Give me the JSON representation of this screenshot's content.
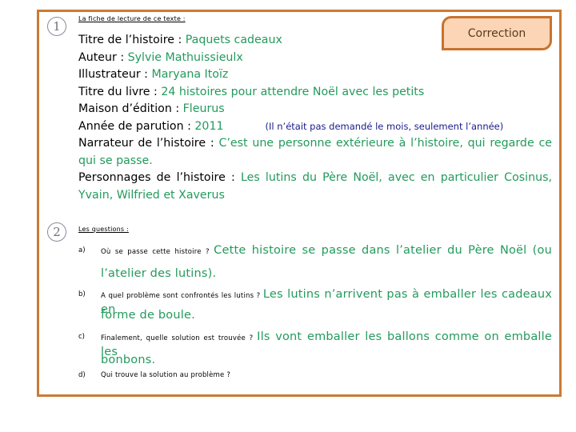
{
  "section1": {
    "number": "1",
    "heading": "La fiche de lecture de ce texte :"
  },
  "badge": {
    "label": "Correction"
  },
  "fiche": {
    "titre": {
      "label": "Titre de l’histoire : ",
      "value": "Paquets cadeaux"
    },
    "auteur": {
      "label": "Auteur : ",
      "value": "Sylvie Mathuissieulx"
    },
    "illustrateur": {
      "label": "Illustrateur : ",
      "value": "Maryana Itoïz"
    },
    "livre": {
      "label": "Titre du livre : ",
      "value": "24 histoires pour attendre Noël avec les petits"
    },
    "edition": {
      "label": "Maison d’édition : ",
      "value": "Fleurus"
    },
    "annee": {
      "label": "Année de parution : ",
      "value": "2011",
      "note": "(Il n’était pas demandé le mois, seulement l’année)"
    },
    "narrateur": {
      "label": "Narrateur de l’histoire : ",
      "value": "C’est une personne extérieure à l’histoire, qui regarde ce qui se passe."
    },
    "personnages": {
      "label": "Personnages de l’histoire : ",
      "value": "Les lutins du Père Noël, avec en particulier Cosinus, Yvain, Wilfried et Xaverus"
    }
  },
  "section2": {
    "number": "2",
    "heading": "Les questions :"
  },
  "questions": [
    {
      "letter": "a)",
      "question": "Où se passe cette histoire ? ",
      "answer_line1": "Cette histoire se passe dans l’atelier du Père Noël (ou",
      "answer_line2": "l’atelier des lutins)."
    },
    {
      "letter": "b)",
      "question": "A quel problème sont confrontés les lutins ? ",
      "answer_line1": "Les lutins n’arrivent pas à emballer les cadeaux en",
      "answer_line2": "forme de boule."
    },
    {
      "letter": "c)",
      "question": "Finalement, quelle solution est trouvée ? ",
      "answer_line1": "Ils vont emballer les ballons comme on emballe les",
      "answer_line2": "bonbons."
    },
    {
      "letter": "d)",
      "question": "Qui trouve la solution au problème ?",
      "answer_line1": "",
      "answer_line2": ""
    }
  ],
  "colors": {
    "frame": "#cc7a35",
    "badge_fill": "#fbd5b5",
    "answer_green": "#239a5c",
    "note_blue": "#1a1a8c"
  }
}
